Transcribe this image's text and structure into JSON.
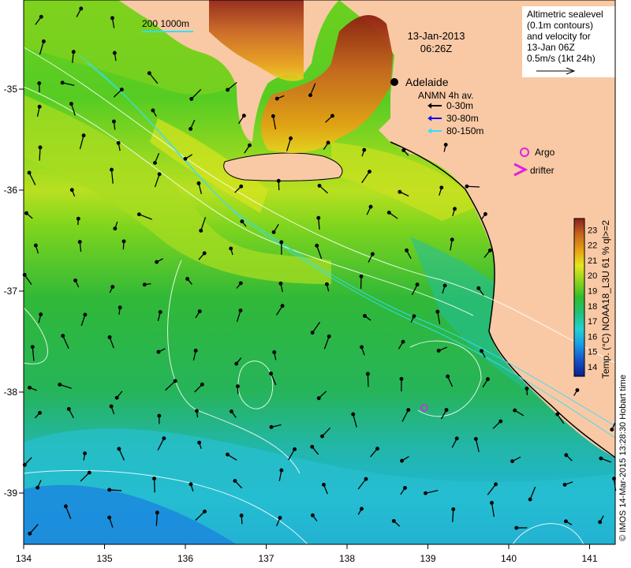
{
  "header": {
    "date": "13-Jan-2013",
    "time": "06:26Z",
    "legend_lines": [
      "Altimetric sealevel",
      "(0.1m contours)",
      "and velocity for",
      "13-Jan 06Z",
      "0.5m/s (1kt 24h)"
    ]
  },
  "bathymetry_label": "200  1000m",
  "city": {
    "name": "Adelaide"
  },
  "anmn": {
    "title": "ANMN 4h av.",
    "items": [
      {
        "label": "0-30m",
        "color": "#000000"
      },
      {
        "label": "30-80m",
        "color": "#1010e0"
      },
      {
        "label": "80-150m",
        "color": "#30e0ff"
      }
    ]
  },
  "markers": {
    "argo_label": "Argo",
    "drifter_label": "drifter",
    "argo_color": "#e020e0"
  },
  "colorbar": {
    "ticks": [
      "14",
      "15",
      "16",
      "17",
      "18",
      "19",
      "20",
      "21",
      "22",
      "23"
    ],
    "label": "Temp. (°C) NOAA18_L3U 61 % ql>=2",
    "colors": [
      "#0b1f8c",
      "#1650c8",
      "#1a9ae6",
      "#22d2d2",
      "#22c07a",
      "#2ebd2e",
      "#8cd21e",
      "#e6e61e",
      "#e6a014",
      "#c8641e",
      "#8c1e1e"
    ]
  },
  "axes": {
    "x_ticks": [
      "134",
      "135",
      "136",
      "137",
      "138",
      "139",
      "140",
      "141"
    ],
    "y_ticks": [
      "-35",
      "-36",
      "-37",
      "-38",
      "-39"
    ]
  },
  "credit": "© IMOS 14-Mar-2015 13:28:30 Hobart time",
  "colors": {
    "land": "#f9c9a5",
    "sea_shallow": "#40c830",
    "sea_deep": "#20b8c8"
  }
}
